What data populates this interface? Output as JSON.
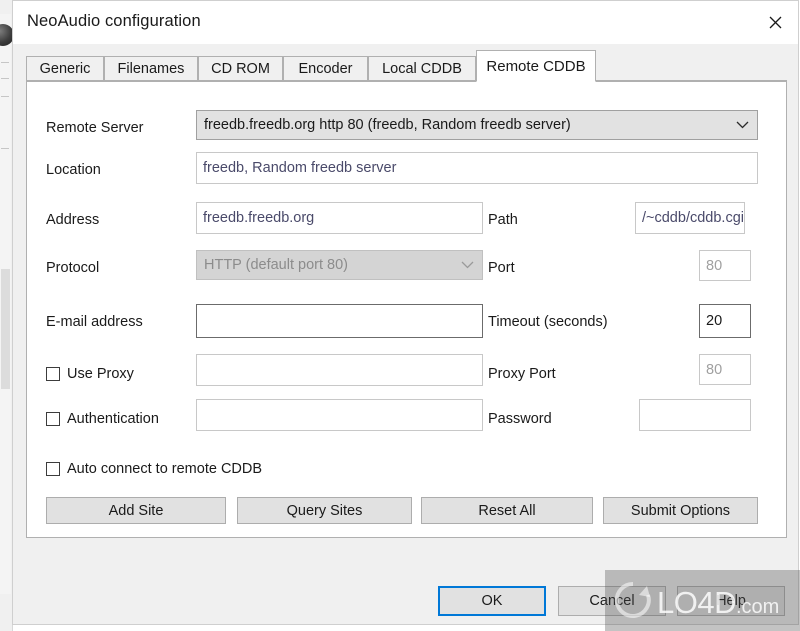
{
  "window": {
    "title": "NeoAudio configuration",
    "close_icon": "close-icon"
  },
  "tabs": [
    {
      "label": "Generic",
      "active": false
    },
    {
      "label": "Filenames",
      "active": false
    },
    {
      "label": "CD ROM",
      "active": false
    },
    {
      "label": "Encoder",
      "active": false
    },
    {
      "label": "Local CDDB",
      "active": false
    },
    {
      "label": "Remote CDDB",
      "active": true
    }
  ],
  "form": {
    "remote_server": {
      "label": "Remote Server",
      "value": "freedb.freedb.org http  80  (freedb, Random freedb server)",
      "chevron_icon": "chevron-down-icon"
    },
    "location": {
      "label": "Location",
      "value": "freedb, Random freedb server"
    },
    "address": {
      "label": "Address",
      "value": "freedb.freedb.org"
    },
    "path": {
      "label": "Path",
      "value": "/~cddb/cddb.cgi"
    },
    "protocol": {
      "label": "Protocol",
      "value": "HTTP (default port 80)",
      "disabled": true,
      "chevron_icon": "chevron-down-icon"
    },
    "port": {
      "label": "Port",
      "value": "80"
    },
    "email": {
      "label": "E-mail address",
      "value": ""
    },
    "timeout": {
      "label": "Timeout (seconds)",
      "value": "20"
    },
    "use_proxy": {
      "label": "Use Proxy",
      "checked": false,
      "value": ""
    },
    "proxy_port": {
      "label": "Proxy Port",
      "value": "80"
    },
    "authentication": {
      "label": "Authentication",
      "checked": false,
      "value": ""
    },
    "password": {
      "label": "Password",
      "value": ""
    },
    "auto_connect": {
      "label": "Auto connect to remote CDDB",
      "checked": false
    }
  },
  "actions": {
    "add_site": "Add Site",
    "query_sites": "Query Sites",
    "reset_all": "Reset All",
    "submit_options": "Submit Options"
  },
  "footer": {
    "ok": "OK",
    "cancel": "Cancel",
    "help": "Help"
  },
  "watermark": {
    "text": "LO4D",
    "suffix": ".com",
    "logo_icon": "refresh-circle-icon"
  },
  "colors": {
    "accent": "#0078d7",
    "dialog_bg": "#f0f0f0",
    "page_bg": "#ffffff",
    "button_bg": "#e1e1e1",
    "field_text": "#4a4a6a",
    "disabled_text": "#8c8c8c"
  }
}
